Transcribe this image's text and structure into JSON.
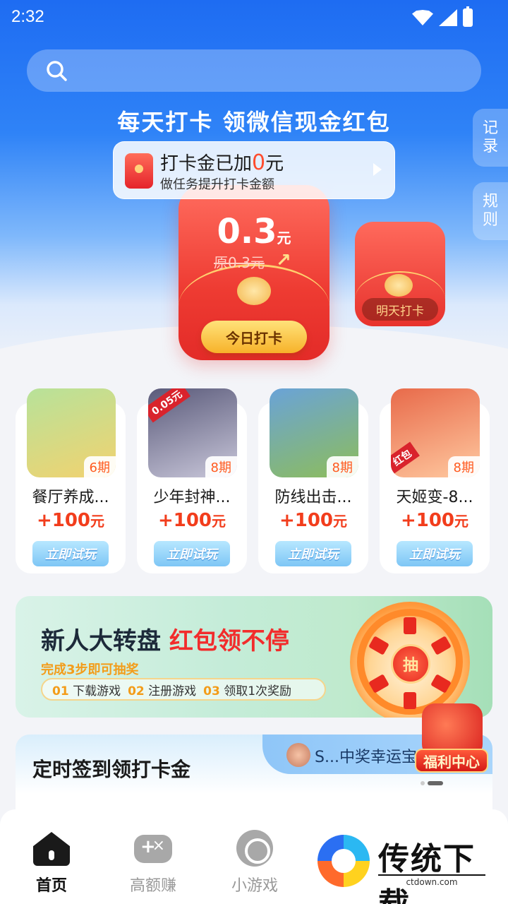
{
  "status_bar": {
    "time": "2:32"
  },
  "header": {
    "title": "每天打卡  领微信现金红包",
    "side_tabs": [
      "记录",
      "规则"
    ]
  },
  "checkin_notice": {
    "line1_prefix": "打卡金已加",
    "line1_amount": "0",
    "line1_suffix": "元",
    "line2": "做任务提升打卡金额"
  },
  "today_packet": {
    "amount": "0.3",
    "unit": "元",
    "original": "原0.3元",
    "button": "今日打卡"
  },
  "tomorrow_packet": {
    "button": "明天打卡"
  },
  "games": [
    {
      "name": "餐厅养成...",
      "period": "6期",
      "reward": "+100",
      "unit": "元",
      "button": "立即试玩",
      "thumb_colors": [
        "#b7e29a",
        "#f2d26f"
      ],
      "tag": ""
    },
    {
      "name": "少年封神...",
      "period": "8期",
      "reward": "+100",
      "unit": "元",
      "button": "立即试玩",
      "thumb_colors": [
        "#5a5a7a",
        "#c9c7da"
      ],
      "tag": "0.05元"
    },
    {
      "name": "防线出击...",
      "period": "8期",
      "reward": "+100",
      "unit": "元",
      "button": "立即试玩",
      "thumb_colors": [
        "#6aa3d8",
        "#8dbd5a"
      ],
      "tag": ""
    },
    {
      "name": "天姬变-8...",
      "period": "8期",
      "reward": "+100",
      "unit": "元",
      "button": "立即试玩",
      "thumb_colors": [
        "#e86a4a",
        "#ffc9a0"
      ],
      "tag": "红包"
    }
  ],
  "wheel_banner": {
    "title_dark": "新人大转盘 ",
    "title_red": "红包领不停",
    "subtitle": "完成3步即可抽奖",
    "steps": [
      {
        "num": "01",
        "label": "下载游戏"
      },
      {
        "num": "02",
        "label": "注册游戏"
      },
      {
        "num": "03",
        "label": "领取1次奖励"
      }
    ],
    "spin_label": "抽"
  },
  "signin": {
    "title": "定时签到领打卡金",
    "ticker": "S...中奖幸运宝"
  },
  "floating": {
    "fuli_label": "福利中心"
  },
  "tabbar": {
    "tabs": [
      {
        "label": "首页",
        "icon": "home-icon",
        "active": true
      },
      {
        "label": "高额赚",
        "icon": "gamepad-icon",
        "active": false
      },
      {
        "label": "小游戏",
        "icon": "mini-game-icon",
        "active": false
      }
    ]
  },
  "watermark": {
    "text": "传统下载",
    "url": "ctdown.com"
  },
  "colors": {
    "primary_blue": "#1e6cf2",
    "red": "#f23d1c",
    "accent_orange": "#f39c19"
  }
}
